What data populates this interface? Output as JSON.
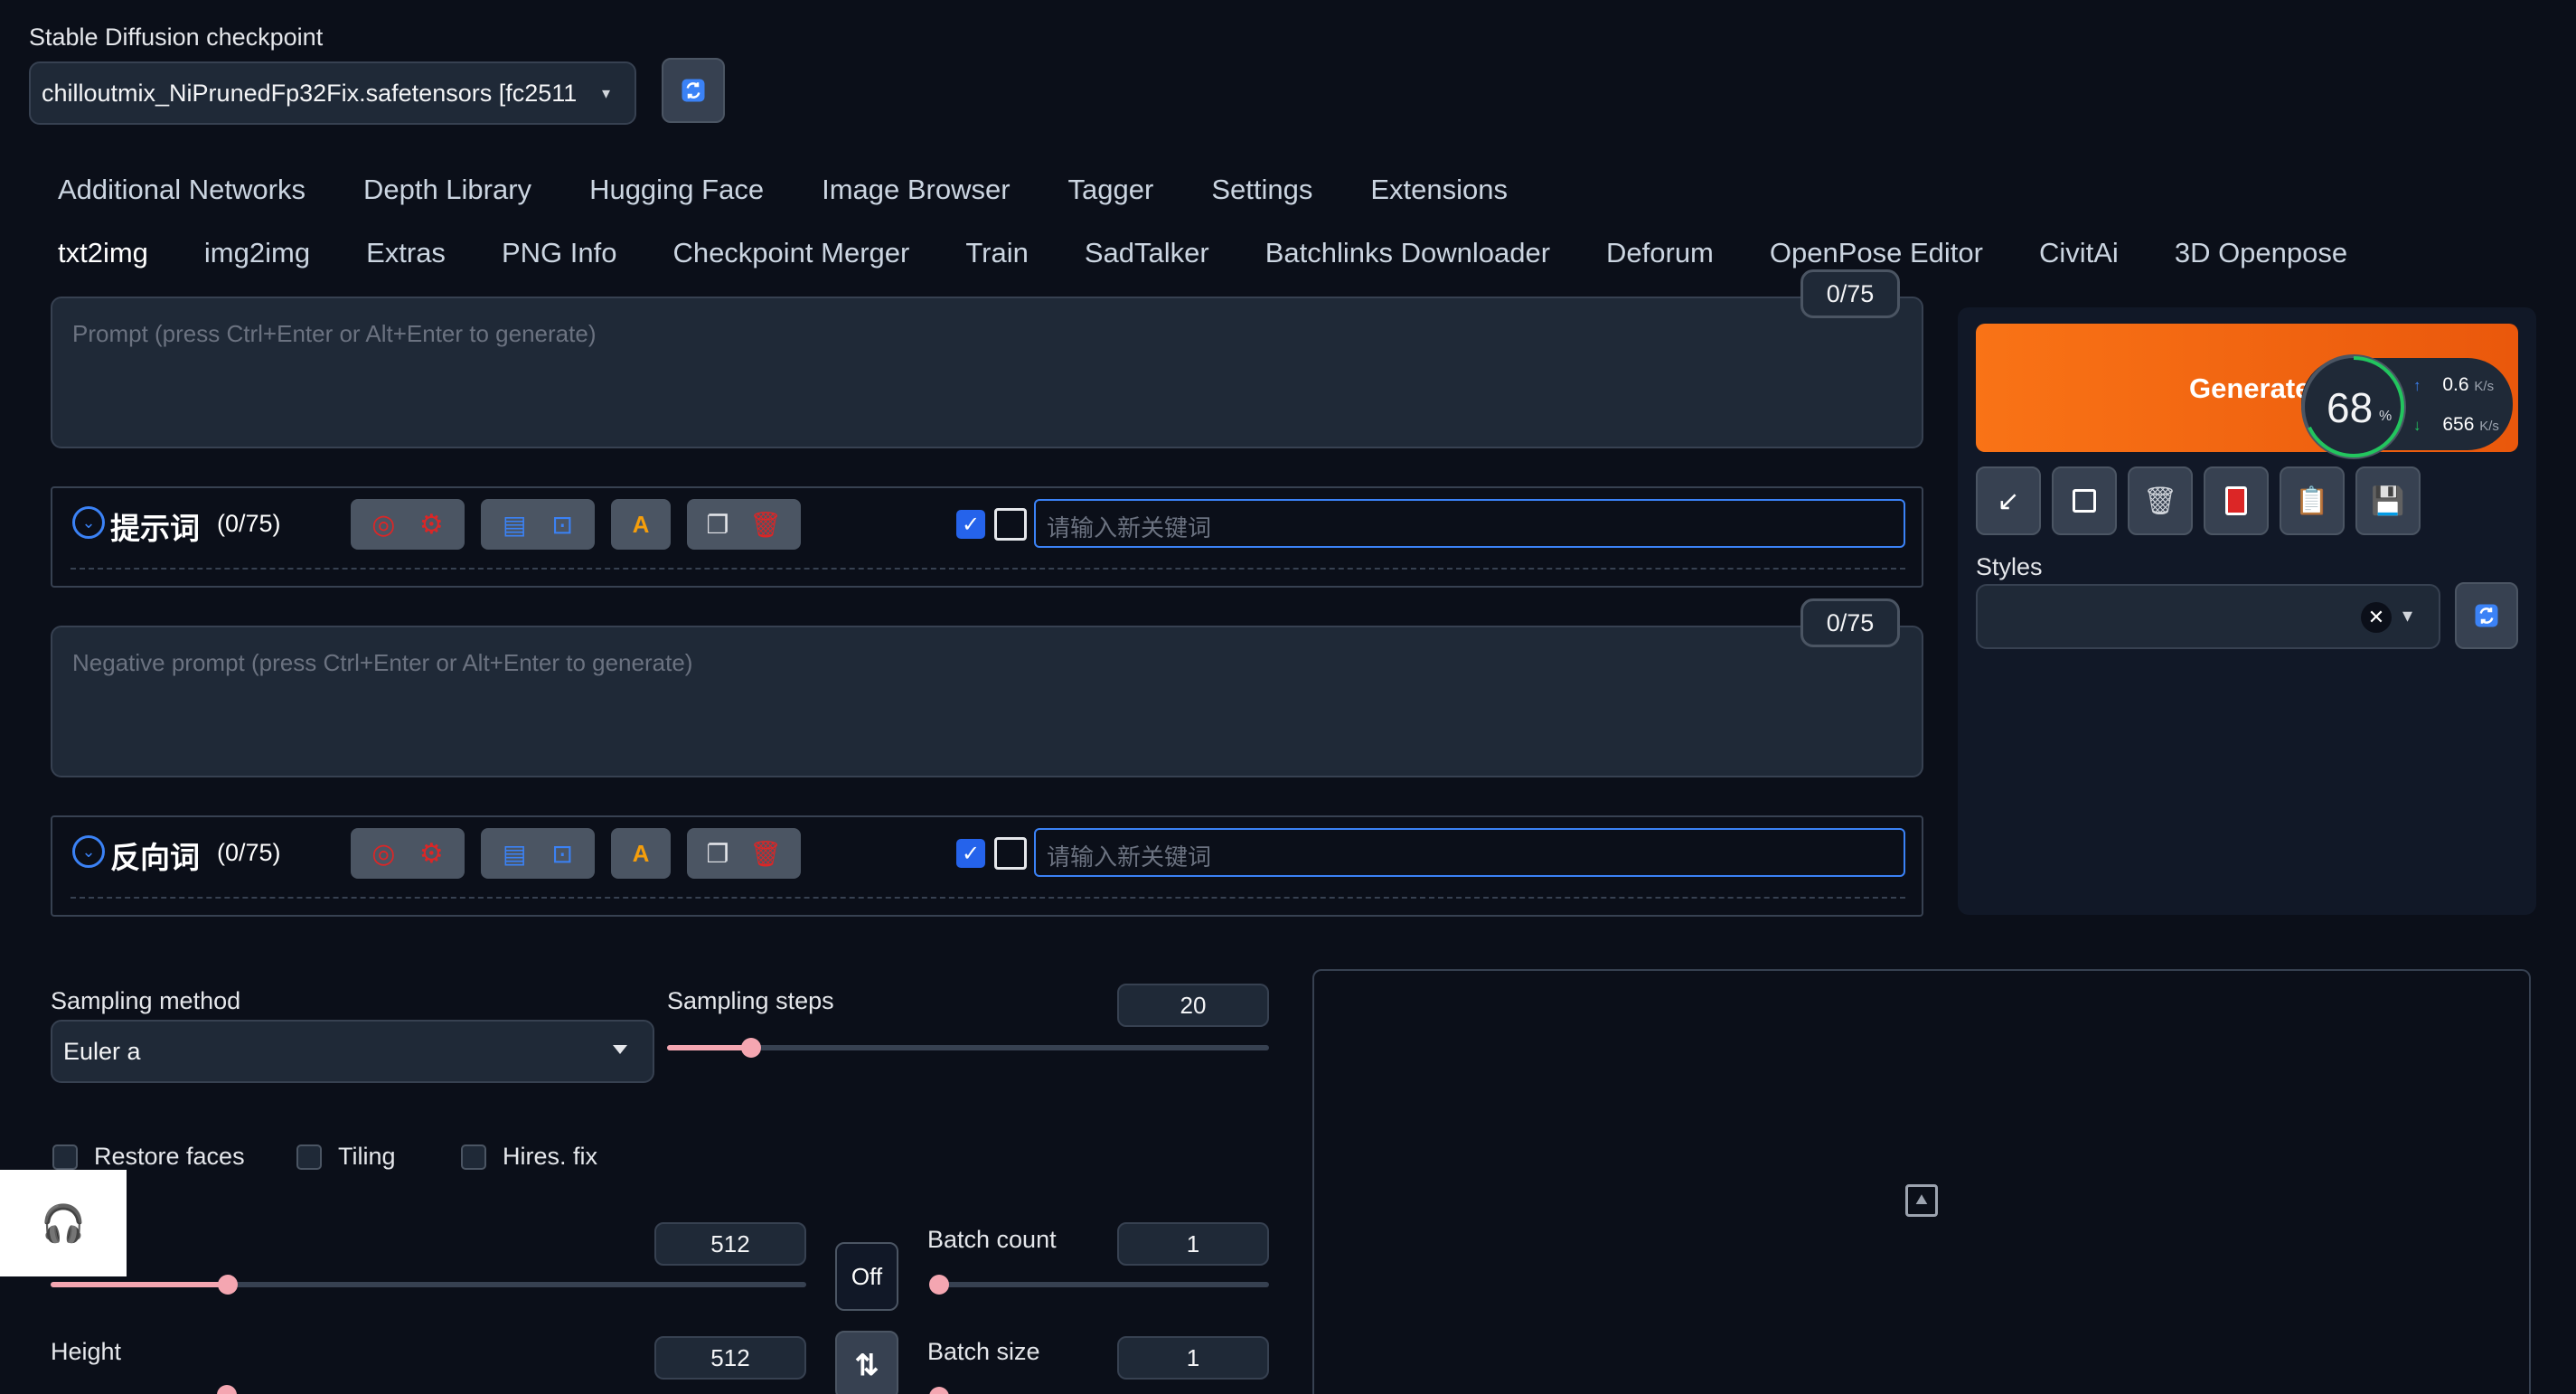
{
  "checkpoint": {
    "label": "Stable Diffusion checkpoint",
    "value": "chilloutmix_NiPrunedFp32Fix.safetensors [fc2511",
    "arrow": "▾"
  },
  "tabs_row1": [
    "Additional Networks",
    "Depth Library",
    "Hugging Face",
    "Image Browser",
    "Tagger",
    "Settings",
    "Extensions"
  ],
  "tabs_row2": [
    "txt2img",
    "img2img",
    "Extras",
    "PNG Info",
    "Checkpoint Merger",
    "Train",
    "SadTalker",
    "Batchlinks Downloader",
    "Deforum",
    "OpenPose Editor",
    "CivitAi",
    "3D Openpose"
  ],
  "prompt": {
    "placeholder": "Prompt (press Ctrl+Enter or Alt+Enter to generate)",
    "counter": "0/75"
  },
  "prompt_helper": {
    "title": "提示词",
    "count": "(0/75)",
    "keyword_placeholder": "请输入新关键词"
  },
  "negative_prompt": {
    "placeholder": "Negative prompt (press Ctrl+Enter or Alt+Enter to generate)",
    "counter": "0/75"
  },
  "negative_helper": {
    "title": "反向词",
    "count": "(0/75)",
    "keyword_placeholder": "请输入新关键词"
  },
  "generate": {
    "label": "Generate",
    "progress": "68",
    "progress_unit": "%",
    "progress_fraction": 0.68,
    "upload_speed": "0.6",
    "download_speed": "656",
    "speed_unit": "K/s"
  },
  "styles": {
    "label": "Styles",
    "clear": "✕",
    "arrow": "▾"
  },
  "sampling": {
    "method_label": "Sampling method",
    "method_value": "Euler a",
    "steps_label": "Sampling steps",
    "steps_value": "20",
    "steps_fraction": 0.14
  },
  "checkboxes": {
    "restore_faces": "Restore faces",
    "tiling": "Tiling",
    "hires_fix": "Hires. fix"
  },
  "size": {
    "width_value": "512",
    "width_fraction": 0.235,
    "height_label": "Height",
    "height_value": "512",
    "toggle_label": "Off"
  },
  "batch": {
    "count_label": "Batch count",
    "count_value": "1",
    "size_label": "Batch size",
    "size_value": "1"
  },
  "colors": {
    "generate": "#ea7324",
    "accent_blue": "#3b82f6",
    "slider": "#f4a6b1",
    "background": "#0b0f19"
  }
}
